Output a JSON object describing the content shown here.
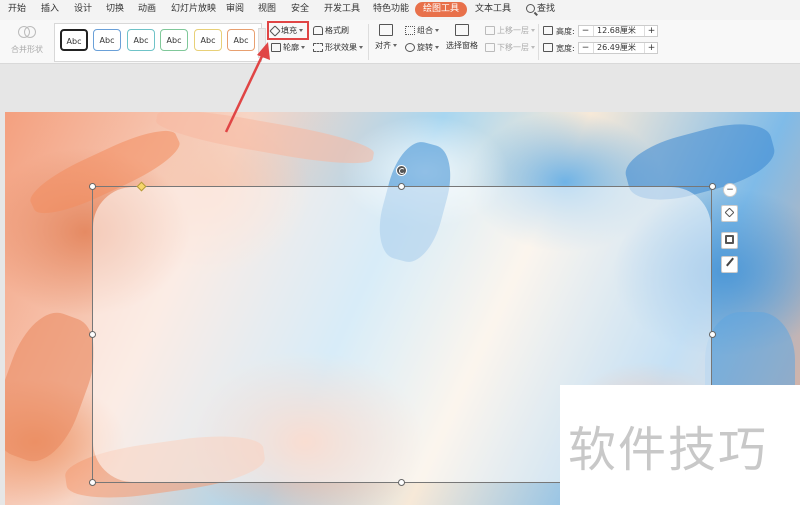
{
  "menu": {
    "tabs": [
      "开始",
      "插入",
      "设计",
      "切换",
      "动画",
      "幻灯片放映",
      "审阅",
      "视图",
      "安全",
      "开发工具",
      "特色功能",
      "绘图工具",
      "文本工具"
    ],
    "active_tab": "绘图工具",
    "search": "查找"
  },
  "ribbon": {
    "merge_shapes": "合并形状",
    "style_swatches": [
      "Abc",
      "Abc",
      "Abc",
      "Abc",
      "Abc",
      "Abc"
    ],
    "fill": "填充",
    "format_painter": "格式刷",
    "outline": "轮廓",
    "shape_effects": "形状效果",
    "align": "对齐",
    "group": "组合",
    "rotate": "旋转",
    "selection_pane": "选择窗格",
    "bring_forward": "上移一层",
    "send_backward": "下移一层",
    "height_label": "高度:",
    "height_value": "12.68厘米",
    "width_label": "宽度:",
    "width_value": "26.49厘米",
    "minus": "−",
    "plus": "+"
  },
  "watermark": "软件技巧",
  "colors": {
    "accent_tab": "#e8704a",
    "highlight_box": "#e04545",
    "arrow": "#e04545"
  }
}
